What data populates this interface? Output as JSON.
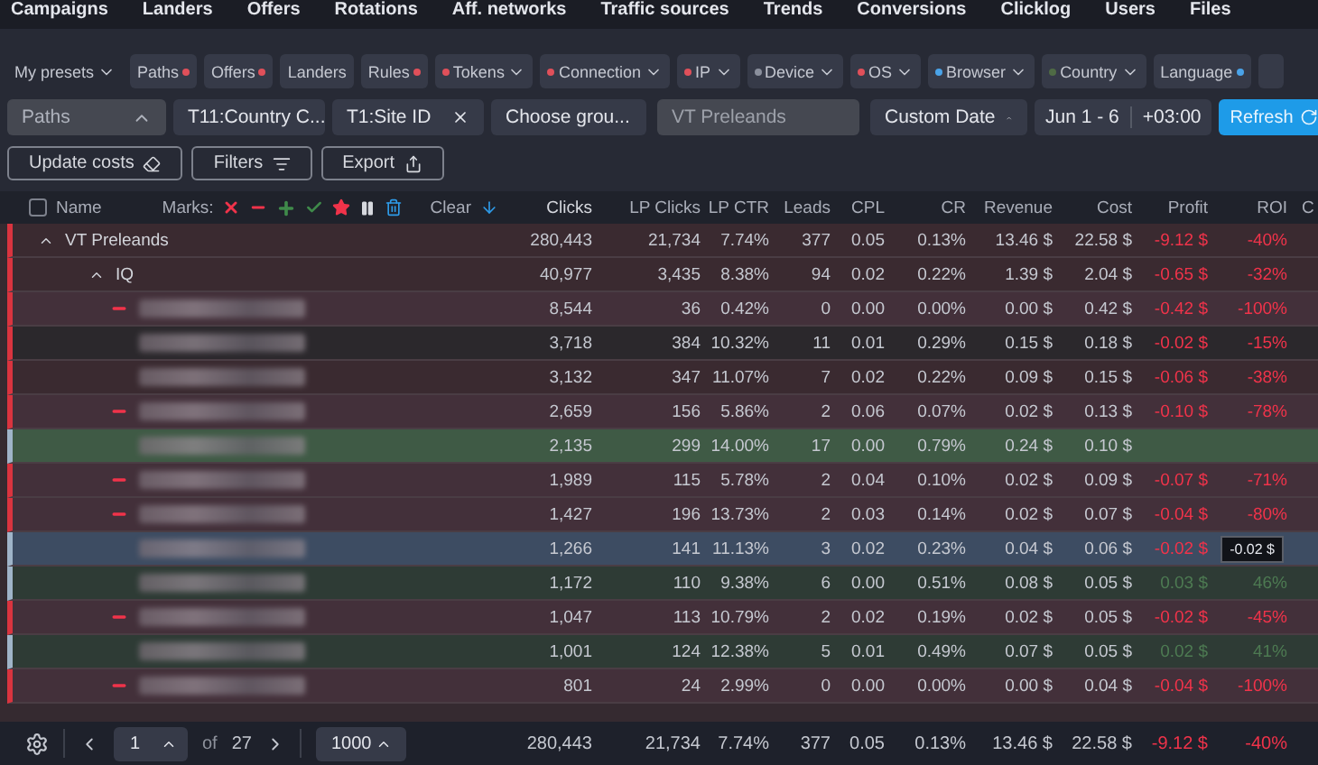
{
  "nav": [
    "Campaigns",
    "Landers",
    "Offers",
    "Rotations",
    "Aff. networks",
    "Traffic sources",
    "Trends",
    "Conversions",
    "Clicklog",
    "Users",
    "Files"
  ],
  "filters": [
    {
      "label": "My presets",
      "kind": "plain",
      "dropdown": true
    },
    {
      "label": "Paths",
      "kind": "dot-after",
      "color": "#e0505a",
      "dropdown": false
    },
    {
      "label": "Offers",
      "kind": "dot-after",
      "color": "#e0505a",
      "dropdown": false
    },
    {
      "label": "Landers",
      "kind": "chip",
      "dropdown": false
    },
    {
      "label": "Rules",
      "kind": "dot-after",
      "color": "#e0505a",
      "dropdown": false
    },
    {
      "label": "Tokens",
      "kind": "dot-before",
      "color": "#e0505a",
      "dropdown": true
    },
    {
      "label": "Connection",
      "kind": "dot-before",
      "color": "#e0505a",
      "dropdown": true
    },
    {
      "label": "IP",
      "kind": "dot-before",
      "color": "#e0505a",
      "dropdown": true
    },
    {
      "label": "Device",
      "kind": "dot-before",
      "color": "#8a8f9c",
      "dropdown": true
    },
    {
      "label": "OS",
      "kind": "dot-before",
      "color": "#e0505a",
      "dropdown": true
    },
    {
      "label": "Browser",
      "kind": "dot-before",
      "color": "#4aa3e8",
      "dropdown": true
    },
    {
      "label": "Country",
      "kind": "dot-before",
      "color": "#4f6b45",
      "dropdown": true
    },
    {
      "label": "Language",
      "kind": "dot-after",
      "color": "#4aa3e8",
      "dropdown": false
    }
  ],
  "grouping": [
    {
      "kind": "select",
      "label": "Paths",
      "muted": true
    },
    {
      "kind": "tag",
      "label": "T11:Country C..."
    },
    {
      "kind": "tag",
      "label": "T1:Site ID"
    },
    {
      "kind": "select",
      "label": "Choose grou...",
      "muted": false
    }
  ],
  "search": {
    "placeholder": "VT Preleands"
  },
  "date": {
    "label": "Custom Date",
    "range": "Jun 1 - 6",
    "timezone": "+03:00"
  },
  "refresh": "Refresh",
  "actions": [
    {
      "label": "Update costs",
      "kind": "eraser"
    },
    {
      "label": "Filters",
      "kind": "filter"
    },
    {
      "label": "Export",
      "kind": "export"
    }
  ],
  "table": {
    "checked": false,
    "name_header": "Name",
    "marks_label": "Marks:",
    "clear": "Clear",
    "columns": [
      {
        "label": "Clicks",
        "sorted": true
      },
      {
        "label": "LP Clicks",
        "sorted": false
      },
      {
        "label": "LP CTR",
        "sorted": false
      },
      {
        "label": "Leads",
        "sorted": false
      },
      {
        "label": "CPL",
        "sorted": false
      },
      {
        "label": "CR",
        "sorted": false
      },
      {
        "label": "Revenue",
        "sorted": false
      },
      {
        "label": "Cost",
        "sorted": false
      },
      {
        "label": "Profit",
        "sorted": false
      },
      {
        "label": "ROI",
        "sorted": false
      }
    ],
    "column_cut": "C",
    "rows": [
      {
        "name": "VT Preleands",
        "expanded": true,
        "kind": "loss",
        "selected": false,
        "values": [
          "280,443",
          "21,734",
          "7.74%",
          "377",
          "0.05",
          "0.13%",
          "13.46 $",
          "22.58 $",
          "-9.12 $",
          "-40%"
        ],
        "children": [
          {
            "name": "IQ",
            "expanded": true,
            "kind": "loss",
            "selected": false,
            "values": [
              "40,977",
              "3,435",
              "8.38%",
              "94",
              "0.02",
              "0.22%",
              "1.39 $",
              "2.04 $",
              "-0.65 $",
              "-32%"
            ],
            "children": [
              {
                "kind": "loss",
                "flagged": true,
                "selected": false,
                "values": [
                  "8,544",
                  "36",
                  "0.42%",
                  "0",
                  "0.00",
                  "0.00%",
                  "0.00 $",
                  "0.42 $",
                  "-0.42 $",
                  "-100%"
                ]
              },
              {
                "kind": "neutral",
                "flagged": false,
                "selected": false,
                "values": [
                  "3,718",
                  "384",
                  "10.32%",
                  "11",
                  "0.01",
                  "0.29%",
                  "0.15 $",
                  "0.18 $",
                  "-0.02 $",
                  "-15%"
                ]
              },
              {
                "kind": "loss",
                "flagged": false,
                "selected": false,
                "values": [
                  "3,132",
                  "347",
                  "11.07%",
                  "7",
                  "0.02",
                  "0.22%",
                  "0.09 $",
                  "0.15 $",
                  "-0.06 $",
                  "-38%"
                ]
              },
              {
                "kind": "loss",
                "flagged": true,
                "selected": false,
                "values": [
                  "2,659",
                  "156",
                  "5.86%",
                  "2",
                  "0.06",
                  "0.07%",
                  "0.02 $",
                  "0.13 $",
                  "-0.10 $",
                  "-78%"
                ]
              },
              {
                "kind": "best",
                "flagged": false,
                "selected": false,
                "values": [
                  "2,135",
                  "299",
                  "14.00%",
                  "17",
                  "0.00",
                  "0.79%",
                  "0.24 $",
                  "0.10 $"
                ]
              },
              {
                "kind": "loss",
                "flagged": true,
                "selected": false,
                "values": [
                  "1,989",
                  "115",
                  "5.78%",
                  "2",
                  "0.04",
                  "0.10%",
                  "0.02 $",
                  "0.09 $",
                  "-0.07 $",
                  "-71%"
                ]
              },
              {
                "kind": "loss",
                "flagged": true,
                "selected": false,
                "values": [
                  "1,427",
                  "196",
                  "13.73%",
                  "2",
                  "0.03",
                  "0.14%",
                  "0.02 $",
                  "0.07 $",
                  "-0.04 $",
                  "-80%"
                ]
              },
              {
                "kind": "loss",
                "flagged": false,
                "selected": true,
                "values": [
                  "1,266",
                  "141",
                  "11.13%",
                  "3",
                  "0.02",
                  "0.23%",
                  "0.04 $",
                  "0.06 $",
                  "-0.02 $"
                ],
                "tooltip": "-0.02 $"
              },
              {
                "kind": "gain",
                "flagged": false,
                "selected": false,
                "values": [
                  "1,172",
                  "110",
                  "9.38%",
                  "6",
                  "0.00",
                  "0.51%",
                  "0.08 $",
                  "0.05 $",
                  "0.03 $",
                  "46%"
                ]
              },
              {
                "kind": "loss",
                "flagged": true,
                "selected": false,
                "values": [
                  "1,047",
                  "113",
                  "10.79%",
                  "2",
                  "0.02",
                  "0.19%",
                  "0.02 $",
                  "0.05 $",
                  "-0.02 $",
                  "-45%"
                ]
              },
              {
                "kind": "gain",
                "flagged": false,
                "selected": false,
                "values": [
                  "1,001",
                  "124",
                  "12.38%",
                  "5",
                  "0.01",
                  "0.49%",
                  "0.07 $",
                  "0.05 $",
                  "0.02 $",
                  "41%"
                ]
              },
              {
                "kind": "loss",
                "flagged": true,
                "selected": false,
                "values": [
                  "801",
                  "24",
                  "2.99%",
                  "0",
                  "0.00",
                  "0.00%",
                  "0.00 $",
                  "0.04 $",
                  "-0.04 $",
                  "-100%"
                ]
              }
            ]
          }
        ]
      }
    ],
    "totals": [
      "280,443",
      "21,734",
      "7.74%",
      "377",
      "0.05",
      "0.13%",
      "13.46 $",
      "22.58 $",
      "-9.12 $",
      "-40%"
    ]
  },
  "pagination": {
    "page": "1",
    "of": "of",
    "pages": "27",
    "per_page": "1000"
  }
}
